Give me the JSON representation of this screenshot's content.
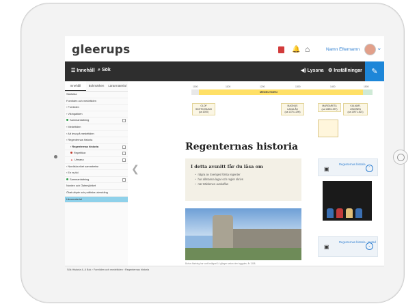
{
  "app": {
    "logo": "gleerups",
    "username": "Namn Efternamn"
  },
  "toolbar": {
    "contents_label": "Innehåll",
    "search_label": "Sök",
    "listen_label": "Lyssna",
    "settings_label": "Inställningar"
  },
  "sidebar": {
    "tabs": [
      "Innehåll",
      "Bokmärken",
      "Lärarmaterial"
    ],
    "items": [
      {
        "label": "Startsida"
      },
      {
        "label": "Forntiden och medeltiden"
      },
      {
        "label": "› Forntiden"
      },
      {
        "label": "› Vikingatiden"
      },
      {
        "label": "Sammanfattning"
      },
      {
        "label": "› Medeltiden"
      },
      {
        "label": "› Att leva på medeltiden"
      },
      {
        "label": "› Regenternas historia"
      },
      {
        "label": "› Regenternas historia"
      },
      {
        "label": "Repetition"
      },
      {
        "label": "Utmana"
      },
      {
        "label": "› Nordiska riket samarbetar"
      },
      {
        "label": "› En ny tid"
      },
      {
        "label": "Sammanfattning"
      },
      {
        "label": "Norden och Östersjöriket"
      },
      {
        "label": "Ökat utbyte och politiska utveckling"
      },
      {
        "label": "Lärarmaterial"
      }
    ]
  },
  "timeline": {
    "ticks": [
      "1000",
      "1100",
      "1200",
      "1300",
      "1400",
      "1500"
    ],
    "band_label": "MEDELTIDEN",
    "people": [
      {
        "name": "OLOF SKÖTKONUNG",
        "years": "(ca 1000)"
      },
      {
        "name": "MAGNUS LADULÅS",
        "years": "(ca 1275-1290)"
      },
      {
        "name": "MARGARETA",
        "years": "(ca 1389-1397)"
      },
      {
        "name": "KALMAR-UNIONEN",
        "years": "(ca 1397-1521)"
      }
    ]
  },
  "main": {
    "title": "Regenternas historia",
    "panel_title": "I detta avsnitt får du läsa om",
    "panel_items": [
      "några av Sveriges första regenter",
      "hur allmänna lagar och regler skrivs",
      "när träldomen avskaffas"
    ],
    "photo_caption": "Bohus fästning har varit belägrat 14 gånger sedan den byggdes. år 1308."
  },
  "videos": [
    {
      "title": "Regenternas historia"
    },
    {
      "title": "Regenternas historia - textad"
    }
  ],
  "footer": {
    "breadcrumb": "Sök Historia 4–6 Bok › Forntiden och medeltiden › Regenternas historia"
  }
}
